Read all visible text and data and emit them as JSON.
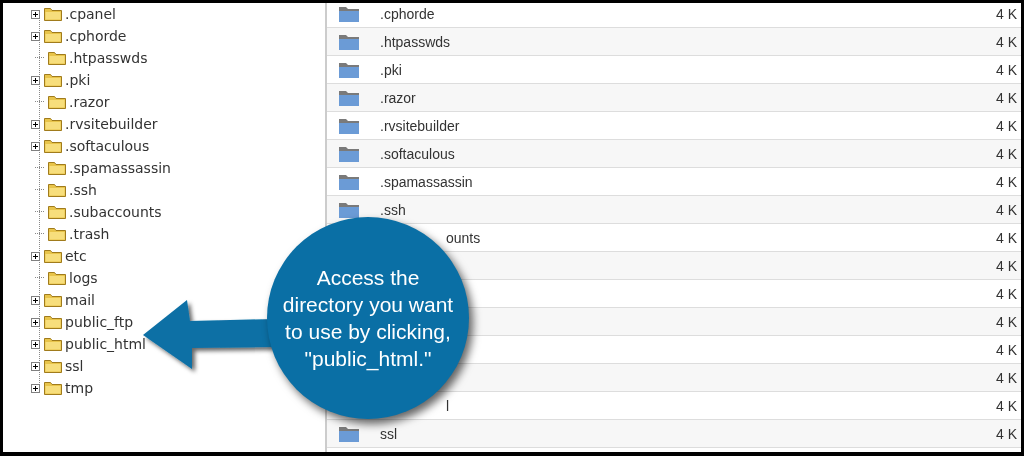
{
  "tree": [
    {
      "name": ".cpanel",
      "expandable": true
    },
    {
      "name": ".cphorde",
      "expandable": true
    },
    {
      "name": ".htpasswds",
      "expandable": false
    },
    {
      "name": ".pki",
      "expandable": true
    },
    {
      "name": ".razor",
      "expandable": false
    },
    {
      "name": ".rvsitebuilder",
      "expandable": true
    },
    {
      "name": ".softaculous",
      "expandable": true
    },
    {
      "name": ".spamassassin",
      "expandable": false
    },
    {
      "name": ".ssh",
      "expandable": false
    },
    {
      "name": ".subaccounts",
      "expandable": false
    },
    {
      "name": ".trash",
      "expandable": false
    },
    {
      "name": "etc",
      "expandable": true
    },
    {
      "name": "logs",
      "expandable": false
    },
    {
      "name": "mail",
      "expandable": true
    },
    {
      "name": "public_ftp",
      "expandable": true
    },
    {
      "name": "public_html",
      "expandable": true
    },
    {
      "name": "ssl",
      "expandable": true
    },
    {
      "name": "tmp",
      "expandable": true
    }
  ],
  "files": [
    {
      "kind": "full",
      "name": ".cphorde",
      "size": "4 K"
    },
    {
      "kind": "full",
      "name": ".htpasswds",
      "size": "4 K"
    },
    {
      "kind": "full",
      "name": ".pki",
      "size": "4 K"
    },
    {
      "kind": "full",
      "name": ".razor",
      "size": "4 K"
    },
    {
      "kind": "full",
      "name": ".rvsitebuilder",
      "size": "4 K"
    },
    {
      "kind": "full",
      "name": ".softaculous",
      "size": "4 K"
    },
    {
      "kind": "full",
      "name": ".spamassassin",
      "size": "4 K"
    },
    {
      "kind": "full",
      "name": ".ssh",
      "size": "4 K"
    },
    {
      "kind": "partial",
      "name": "ounts",
      "size": "4 K"
    },
    {
      "kind": "hidden",
      "size": "4 K"
    },
    {
      "kind": "hidden",
      "size": "4 K"
    },
    {
      "kind": "hidden",
      "size": "4 K"
    },
    {
      "kind": "hidden",
      "size": "4 K"
    },
    {
      "kind": "hidden",
      "size": "4 K"
    },
    {
      "kind": "partial",
      "name": "l",
      "size": "4 K"
    },
    {
      "kind": "full",
      "name": "ssl",
      "size": "4 K"
    }
  ],
  "callout": {
    "text": "Access the\ndirectory you want\nto use by clicking,\n\"public_html.\""
  }
}
